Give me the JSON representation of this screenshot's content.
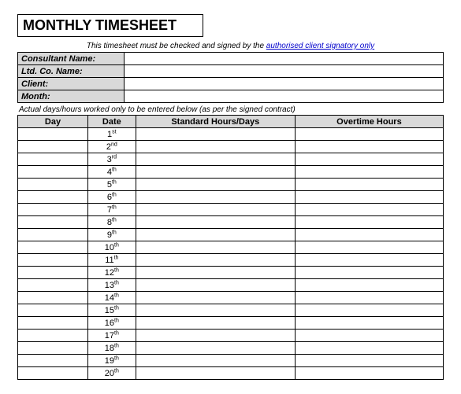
{
  "title": "MONTHLY TIMESHEET",
  "notice_prefix": "This timesheet must be checked and signed by the ",
  "notice_link": "authorised client signatory only",
  "info": {
    "consultant_name_label": "Consultant Name:",
    "consultant_name_value": "",
    "ltd_co_name_label": "Ltd. Co. Name:",
    "ltd_co_name_value": "",
    "client_label": "Client:",
    "client_value": "",
    "month_label": "Month:",
    "month_value": ""
  },
  "instruction": "Actual days/hours worked only to be entered below (as per the signed contract)",
  "columns": {
    "day": "Day",
    "date": "Date",
    "standard": "Standard Hours/Days",
    "overtime": "Overtime Hours"
  },
  "rows": [
    {
      "day": "",
      "date_num": "1",
      "date_suffix": "st",
      "standard": "",
      "overtime": ""
    },
    {
      "day": "",
      "date_num": "2",
      "date_suffix": "nd",
      "standard": "",
      "overtime": ""
    },
    {
      "day": "",
      "date_num": "3",
      "date_suffix": "rd",
      "standard": "",
      "overtime": ""
    },
    {
      "day": "",
      "date_num": "4",
      "date_suffix": "th",
      "standard": "",
      "overtime": ""
    },
    {
      "day": "",
      "date_num": "5",
      "date_suffix": "th",
      "standard": "",
      "overtime": ""
    },
    {
      "day": "",
      "date_num": "6",
      "date_suffix": "th",
      "standard": "",
      "overtime": ""
    },
    {
      "day": "",
      "date_num": "7",
      "date_suffix": "th",
      "standard": "",
      "overtime": ""
    },
    {
      "day": "",
      "date_num": "8",
      "date_suffix": "th",
      "standard": "",
      "overtime": ""
    },
    {
      "day": "",
      "date_num": "9",
      "date_suffix": "th",
      "standard": "",
      "overtime": ""
    },
    {
      "day": "",
      "date_num": "10",
      "date_suffix": "th",
      "standard": "",
      "overtime": ""
    },
    {
      "day": "",
      "date_num": "11",
      "date_suffix": "th",
      "standard": "",
      "overtime": ""
    },
    {
      "day": "",
      "date_num": "12",
      "date_suffix": "th",
      "standard": "",
      "overtime": ""
    },
    {
      "day": "",
      "date_num": "13",
      "date_suffix": "th",
      "standard": "",
      "overtime": ""
    },
    {
      "day": "",
      "date_num": "14",
      "date_suffix": "th",
      "standard": "",
      "overtime": ""
    },
    {
      "day": "",
      "date_num": "15",
      "date_suffix": "th",
      "standard": "",
      "overtime": ""
    },
    {
      "day": "",
      "date_num": "16",
      "date_suffix": "th",
      "standard": "",
      "overtime": ""
    },
    {
      "day": "",
      "date_num": "17",
      "date_suffix": "th",
      "standard": "",
      "overtime": ""
    },
    {
      "day": "",
      "date_num": "18",
      "date_suffix": "th",
      "standard": "",
      "overtime": ""
    },
    {
      "day": "",
      "date_num": "19",
      "date_suffix": "th",
      "standard": "",
      "overtime": ""
    },
    {
      "day": "",
      "date_num": "20",
      "date_suffix": "th",
      "standard": "",
      "overtime": ""
    }
  ]
}
